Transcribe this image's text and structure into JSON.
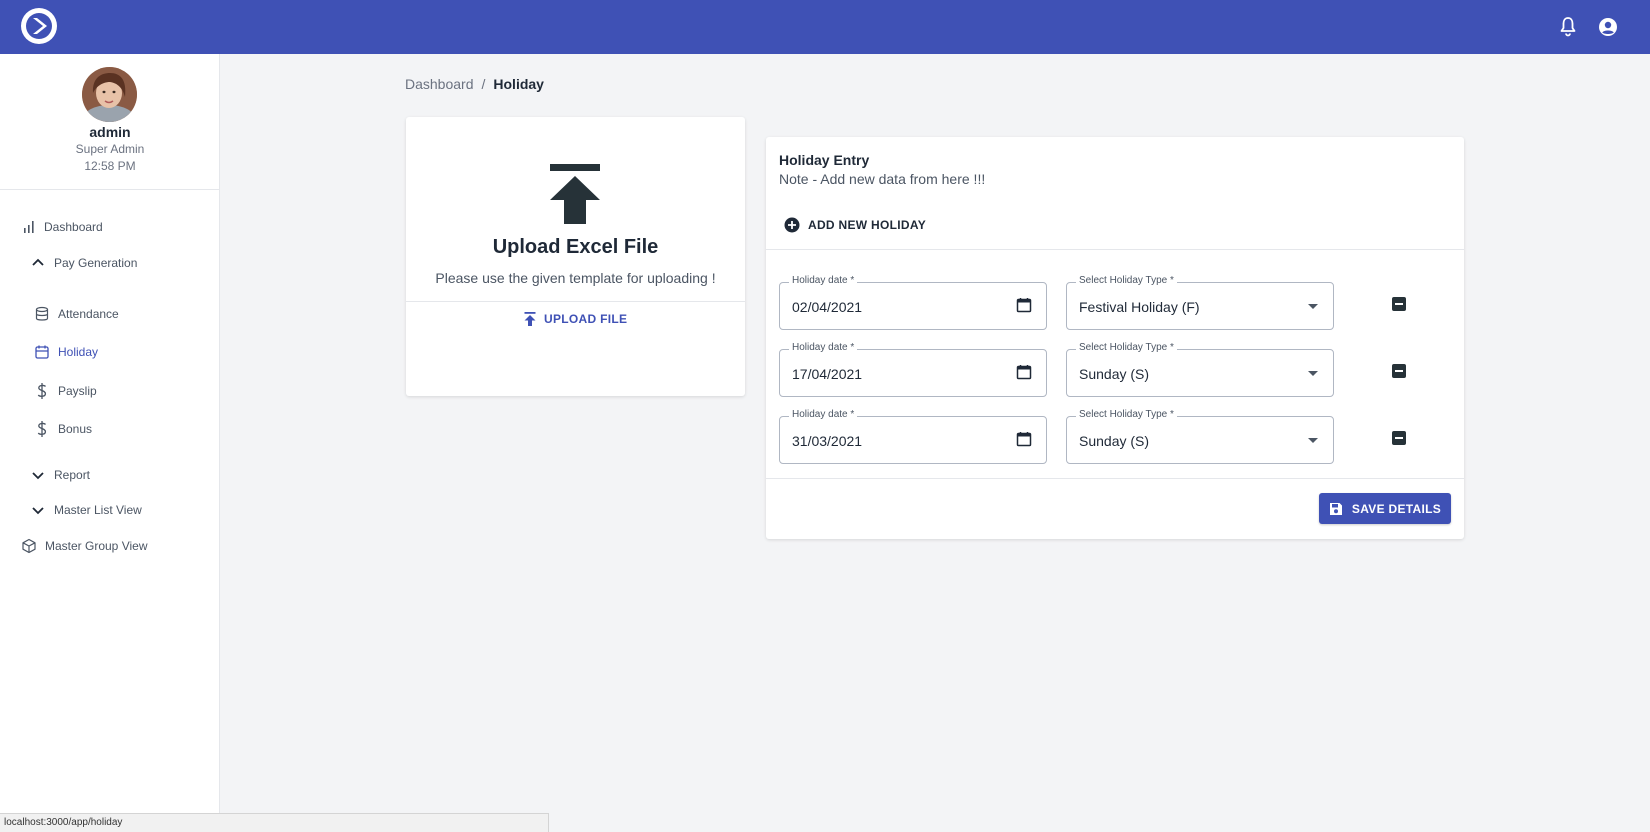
{
  "topbar": {
    "logo": "app-logo",
    "notifications_icon": "bell-icon",
    "account_icon": "account-circle-icon"
  },
  "sidebar": {
    "user": {
      "name": "admin",
      "role": "Super Admin",
      "time": "12:58 PM"
    },
    "items": [
      {
        "label": "Dashboard",
        "icon": "bar-chart-icon"
      },
      {
        "label": "Pay Generation",
        "icon": "chevron-up-icon"
      },
      {
        "label": "Attendance",
        "icon": "database-icon"
      },
      {
        "label": "Holiday",
        "icon": "calendar-icon",
        "active": true
      },
      {
        "label": "Payslip",
        "icon": "dollar-icon"
      },
      {
        "label": "Bonus",
        "icon": "dollar-icon"
      },
      {
        "label": "Report",
        "icon": "chevron-down-icon"
      },
      {
        "label": "Master List View",
        "icon": "chevron-down-icon"
      },
      {
        "label": "Master Group View",
        "icon": "cube-icon"
      }
    ]
  },
  "breadcrumb": {
    "parent": "Dashboard",
    "separator": "/",
    "current": "Holiday"
  },
  "upload": {
    "title": "Upload Excel File",
    "subtitle": "Please use the given template for uploading !",
    "button": "UPLOAD FILE"
  },
  "holiday_entry": {
    "title": "Holiday Entry",
    "note": "Note - Add new data from here !!!",
    "add_button": "ADD NEW HOLIDAY",
    "date_label": "Holiday date *",
    "type_label": "Select Holiday Type *",
    "rows": [
      {
        "date": "02/04/2021",
        "type": "Festival Holiday (F)"
      },
      {
        "date": "17/04/2021",
        "type": "Sunday (S)"
      },
      {
        "date": "31/03/2021",
        "type": "Sunday (S)"
      }
    ],
    "save_button": "SAVE DETAILS"
  },
  "status_bar": {
    "url": "localhost:3000/app/holiday"
  },
  "colors": {
    "primary": "#3f51b5",
    "background": "#f3f4f6"
  }
}
